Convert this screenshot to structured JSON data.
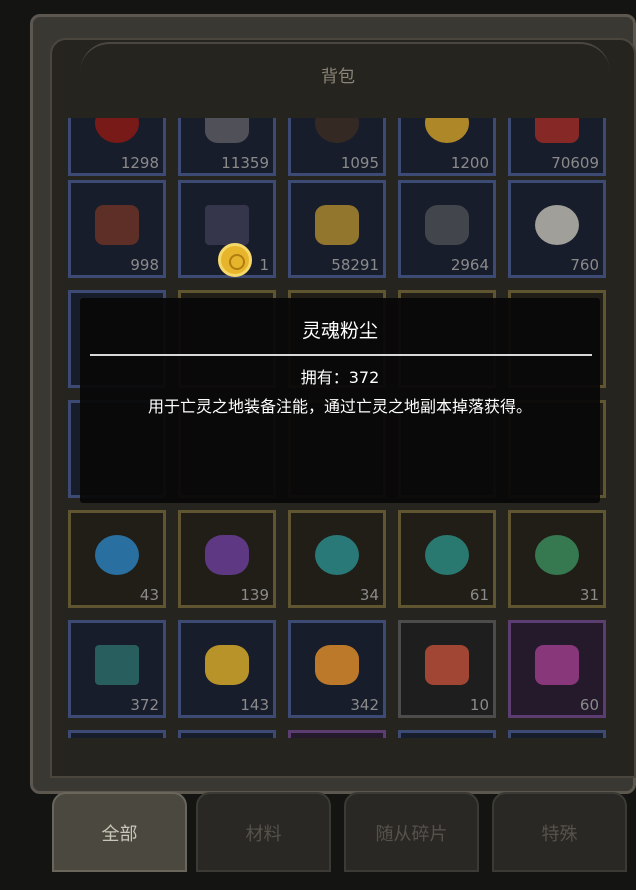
{
  "title": "背包",
  "rows": [
    [
      {
        "count": "1298",
        "icon": "red-armor-icon",
        "border": "blue"
      },
      {
        "count": "11359",
        "icon": "dark-armor-icon",
        "border": "blue"
      },
      {
        "count": "1095",
        "icon": "dark-orb-icon",
        "border": "blue"
      },
      {
        "count": "1200",
        "icon": "gold-item-icon",
        "border": "blue"
      },
      {
        "count": "70609",
        "icon": "red-robot-icon",
        "border": "blue"
      }
    ],
    [
      {
        "count": "998",
        "icon": "dark-claw-icon",
        "border": "blue"
      },
      {
        "count": "1",
        "icon": "dark-pyramid-icon",
        "border": "blue"
      },
      {
        "count": "58291",
        "icon": "golden-helmet-icon",
        "border": "blue"
      },
      {
        "count": "2964",
        "icon": "horned-helmet-icon",
        "border": "blue"
      },
      {
        "count": "760",
        "icon": "stone-disc-icon",
        "border": "blue"
      }
    ],
    [
      {
        "count": "43",
        "icon": "rune-v-icon",
        "border": "gold"
      },
      {
        "count": "139",
        "icon": "purple-crystal-icon",
        "border": "gold"
      },
      {
        "count": "34",
        "icon": "rune-i-icon",
        "border": "gold"
      },
      {
        "count": "61",
        "icon": "rune-ii-icon",
        "border": "gold"
      },
      {
        "count": "31",
        "icon": "rune-iii-icon",
        "border": "gold"
      }
    ],
    [
      {
        "count": "372",
        "icon": "soul-dust-icon",
        "border": "blue"
      },
      {
        "count": "143",
        "icon": "yellow-gem-icon",
        "border": "blue"
      },
      {
        "count": "342",
        "icon": "orange-gem-icon",
        "border": "blue"
      },
      {
        "count": "10",
        "icon": "red-hair-portrait-icon",
        "border": "grey"
      },
      {
        "count": "60",
        "icon": "masked-portrait-icon",
        "border": "purple"
      }
    ]
  ],
  "popup": {
    "name": "灵魂粉尘",
    "owned": "拥有：372",
    "description": "用于亡灵之地装备注能，通过亡灵之地副本掉落获得。"
  },
  "tabs": [
    {
      "label": "全部",
      "active": true
    },
    {
      "label": "材料",
      "active": false
    },
    {
      "label": "随从碎片",
      "active": false
    },
    {
      "label": "特殊",
      "active": false
    }
  ],
  "colors": {
    "blue_border": "#3d4a74",
    "gold_border": "#5f5530",
    "purple_border": "#5c3d72",
    "coin": "#e7b52c"
  }
}
